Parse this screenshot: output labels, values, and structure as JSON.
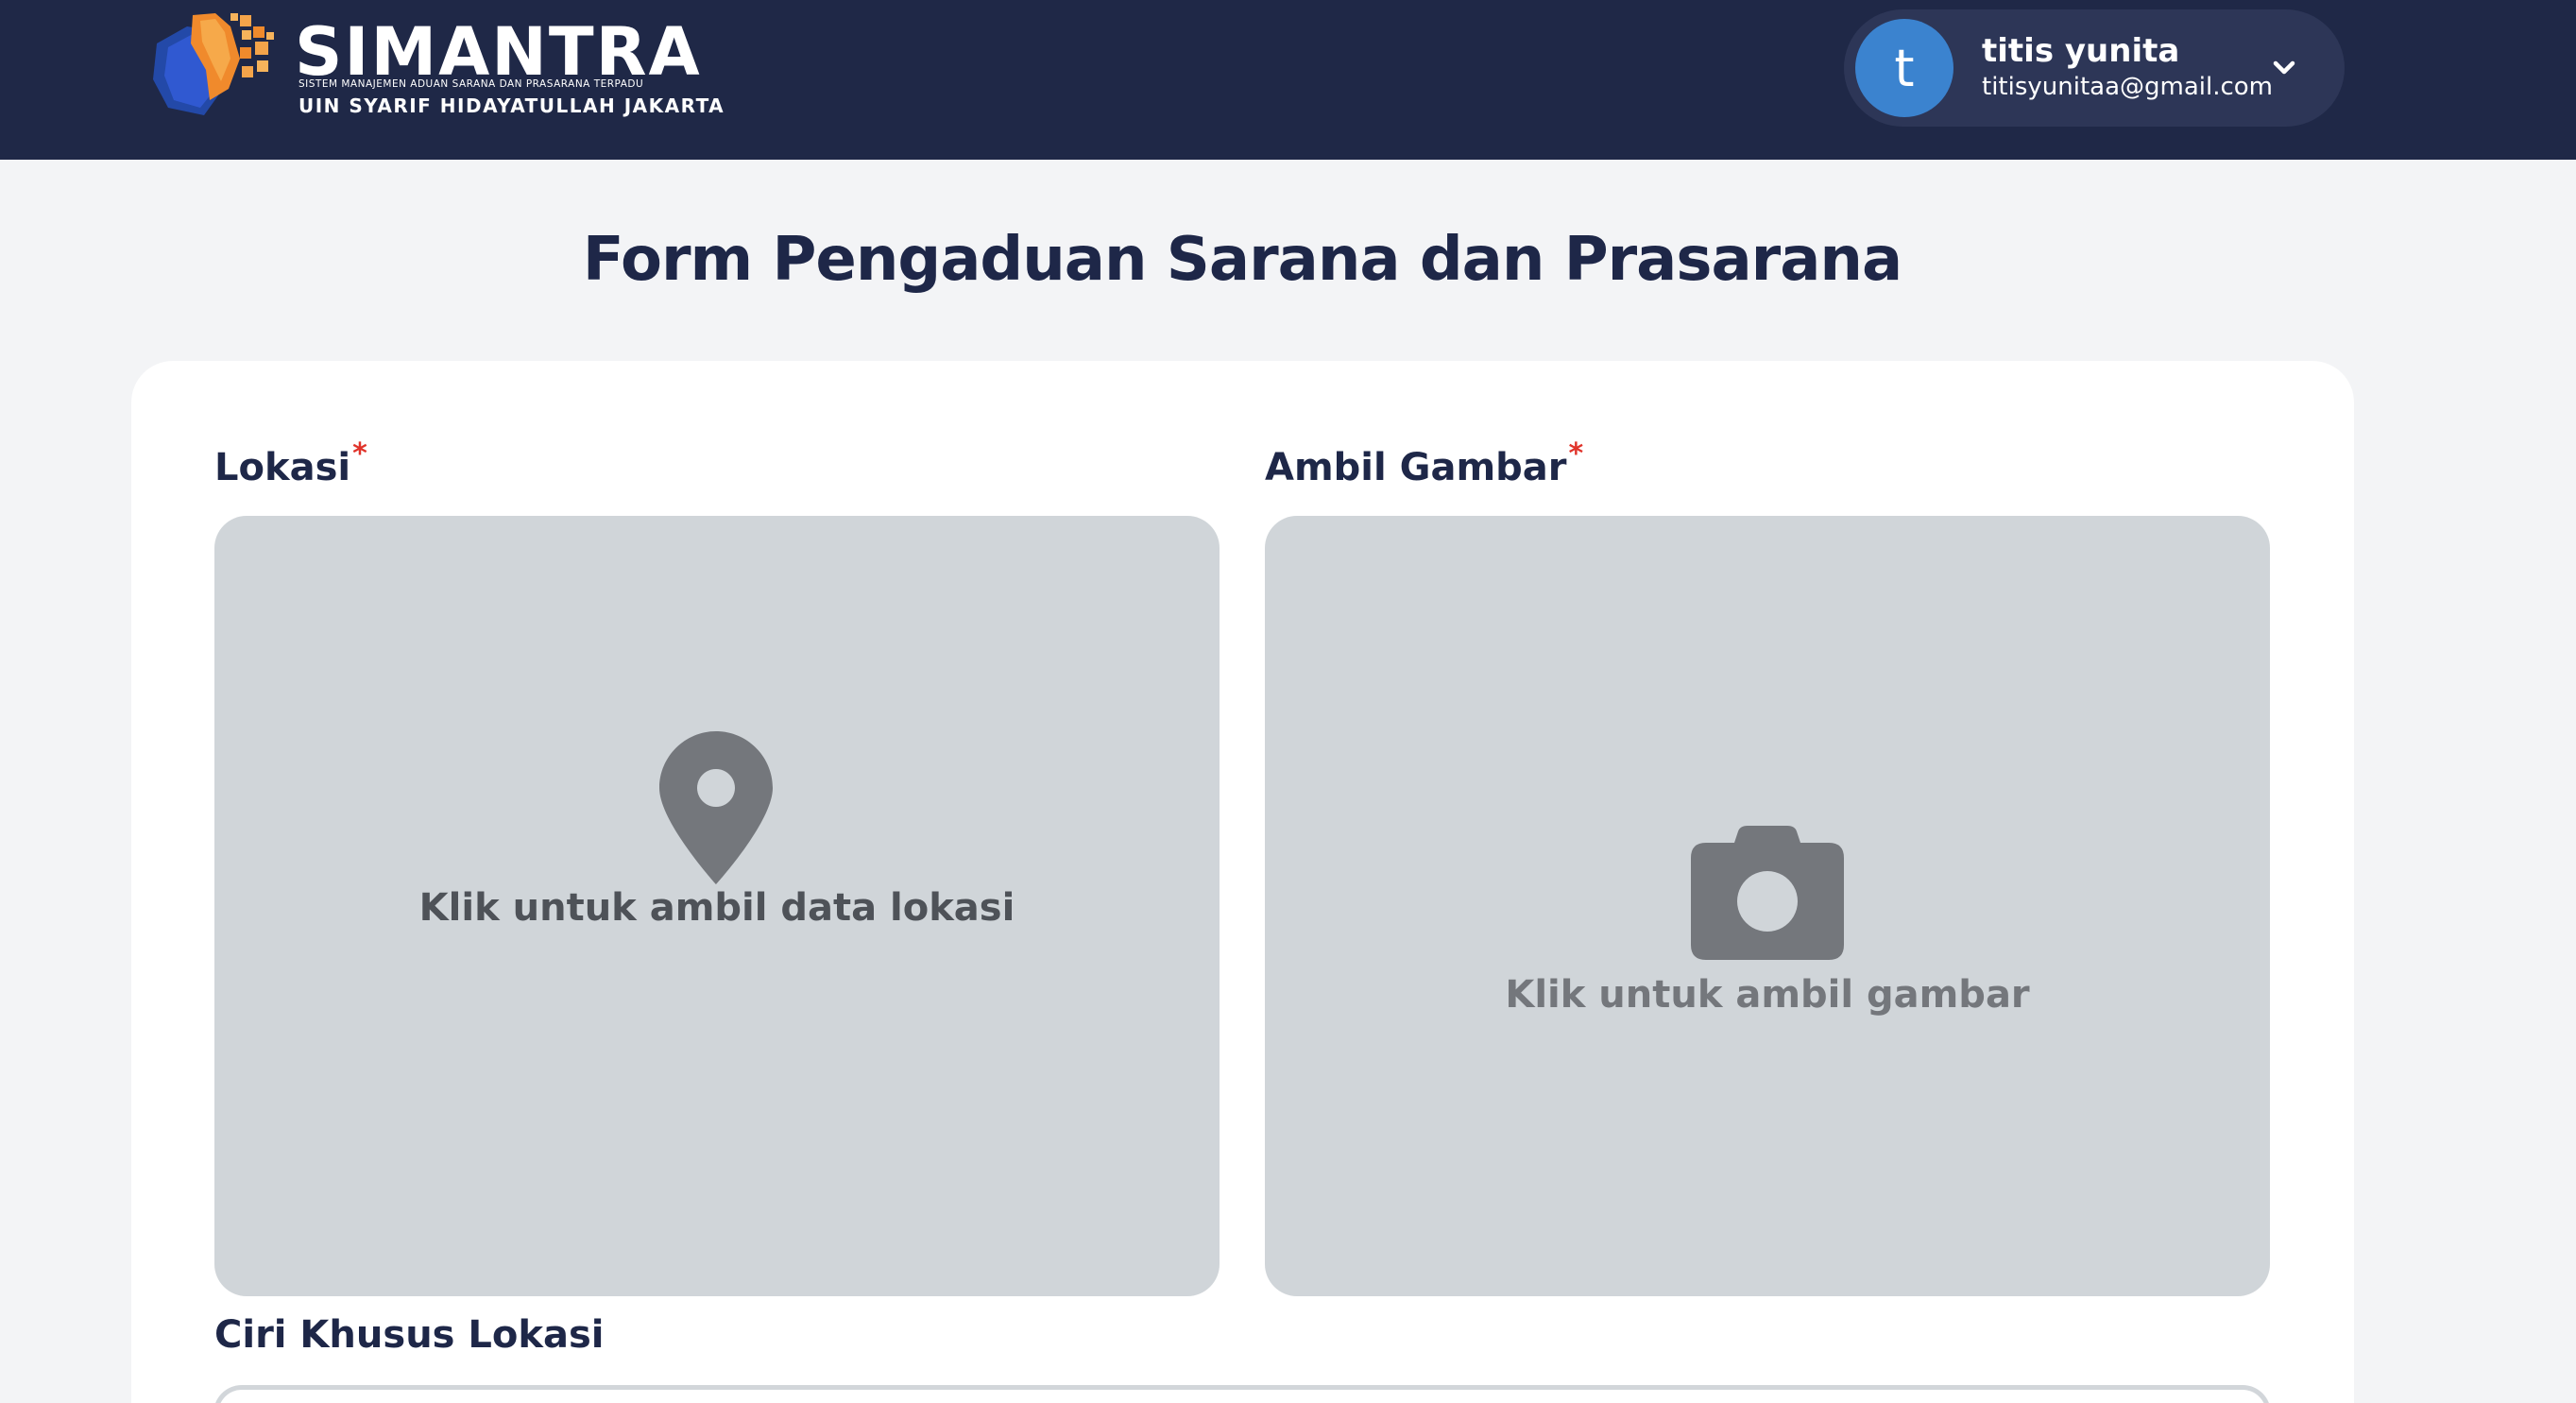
{
  "header": {
    "brand": {
      "title": "SIMANTRA",
      "tagline": "SISTEM MANAJEMEN ADUAN SARANA DAN PRASARANA TERPADU",
      "university": "UIN SYARIF HIDAYATULLAH JAKARTA"
    },
    "user": {
      "initial": "t",
      "name": "titis yunita",
      "email": "titisyunitaa@gmail.com",
      "menu_icon": "chevron-down-icon"
    }
  },
  "page": {
    "title": "Form Pengaduan Sarana dan Prasarana"
  },
  "form": {
    "location": {
      "label": "Lokasi",
      "required_mark": "*",
      "icon": "map-pin-icon",
      "prompt": "Klik untuk ambil data lokasi"
    },
    "image": {
      "label": "Ambil Gambar",
      "required_mark": "*",
      "icon": "camera-icon",
      "prompt": "Klik untuk ambil gambar"
    },
    "location_feature": {
      "label": "Ciri Khusus Lokasi",
      "value": ""
    }
  },
  "colors": {
    "navbar": "#1f2847",
    "avatar": "#3b83cf",
    "required": "#e0342b",
    "upload_box": "#d0d5d9",
    "icon": "#74777c"
  }
}
